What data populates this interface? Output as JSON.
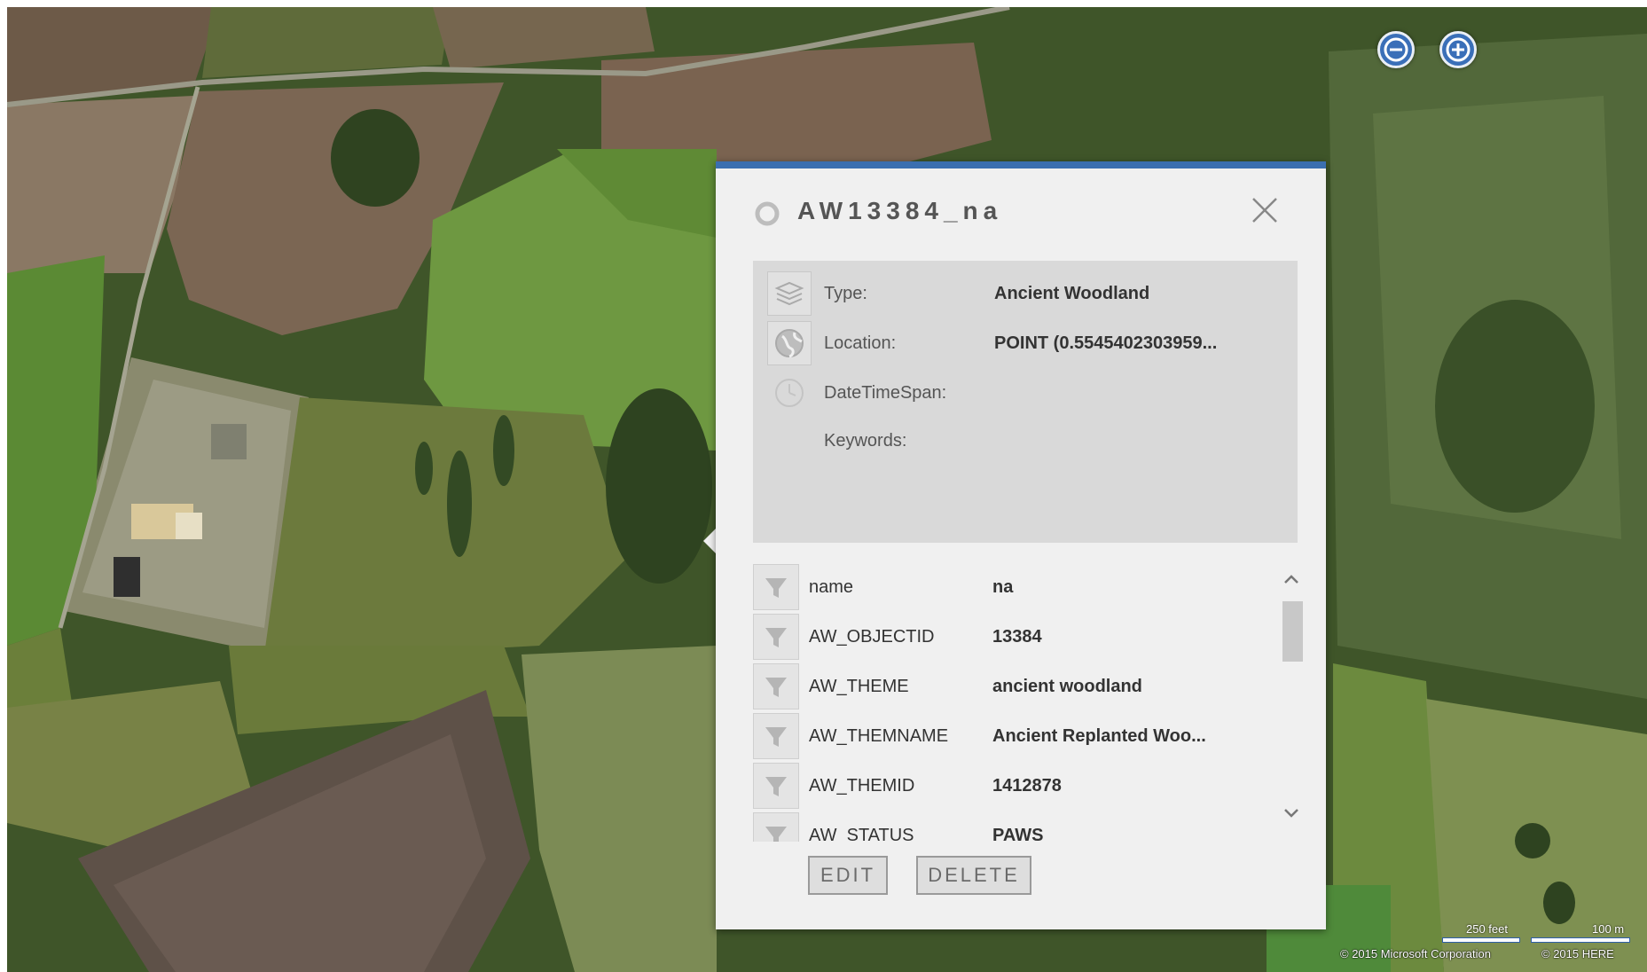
{
  "map": {
    "zoom_out_label": "−",
    "zoom_in_label": "+",
    "scale_feet": "250 feet",
    "scale_meters": "100 m",
    "attribution_microsoft": "© 2015 Microsoft Corporation",
    "attribution_here": "© 2015 HERE"
  },
  "popup": {
    "title": "AW13384_na",
    "summary": [
      {
        "label": "Type:",
        "value": "Ancient Woodland",
        "icon": "layers-icon"
      },
      {
        "label": "Location:",
        "value": "POINT (0.5545402303959...",
        "icon": "globe-icon"
      },
      {
        "label": "DateTimeSpan:",
        "value": "",
        "icon": "clock-icon"
      },
      {
        "label": "Keywords:",
        "value": "",
        "icon": ""
      }
    ],
    "attributes": [
      {
        "name": "name",
        "value": "na"
      },
      {
        "name": "AW_OBJECTID",
        "value": "13384"
      },
      {
        "name": "AW_THEME",
        "value": "ancient woodland"
      },
      {
        "name": "AW_THEMNAME",
        "value": "Ancient Replanted Woo..."
      },
      {
        "name": "AW_THEMID",
        "value": "1412878"
      },
      {
        "name": "AW_STATUS",
        "value": "PAWS"
      }
    ],
    "edit_label": "EDIT",
    "delete_label": "DELETE"
  },
  "colors": {
    "accent": "#3b6fb0",
    "popup_bg": "#f0f0f0",
    "summary_bg": "#d9d9d9"
  }
}
